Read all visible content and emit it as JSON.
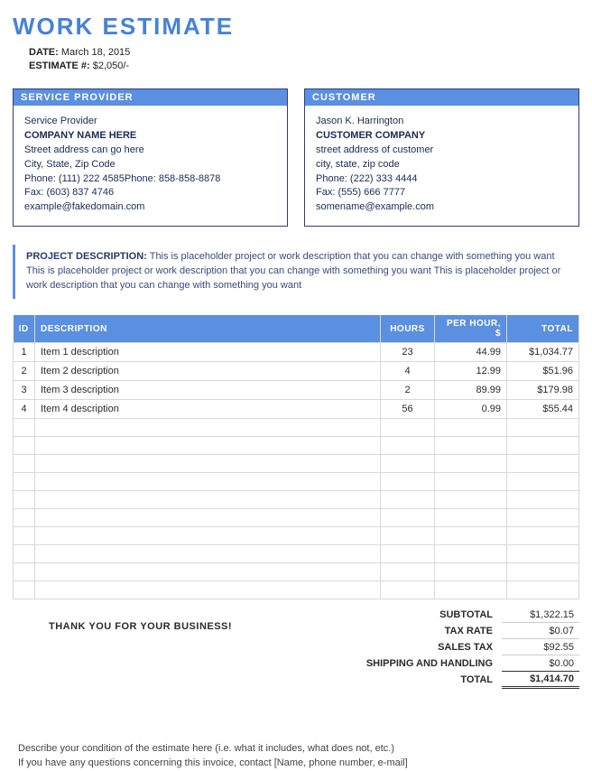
{
  "header": {
    "title": "WORK ESTIMATE",
    "date_label": "DATE:",
    "date_value": "March 18, 2015",
    "estimate_label": "ESTIMATE #:",
    "estimate_value": "$2,050/-"
  },
  "provider": {
    "heading": "SERVICE PROVIDER",
    "line1": "Service Provider",
    "company": "COMPANY NAME HERE",
    "address1": "Street address can go here",
    "address2": "City, State, Zip Code",
    "phone": "Phone:  (111) 222 4585Phone: 858-858-8878",
    "fax": "Fax: (603) 837 4746",
    "email": "example@fakedomain.com"
  },
  "customer": {
    "heading": "CUSTOMER",
    "line1": "Jason K. Harrington",
    "company": "CUSTOMER COMPANY",
    "address1": "street address of customer",
    "address2": "city, state, zip code",
    "phone": "Phone: (222) 333 4444",
    "fax": "Fax: (555) 666 7777",
    "email": "somename@example.com"
  },
  "project": {
    "label": "PROJECT DESCRIPTION:",
    "text": "This is placeholder project or work description that you can change with something you want This is placeholder project or work description that you can change with something you want  This is placeholder project or work description that you can change with something you want"
  },
  "table": {
    "headers": {
      "id": "ID",
      "desc": "DESCRIPTION",
      "hours": "HOURS",
      "rate": "PER HOUR, $",
      "total": "TOTAL"
    },
    "rows": [
      {
        "id": "1",
        "desc": "Item 1 description",
        "hours": "23",
        "rate": "44.99",
        "total": "$1,034.77"
      },
      {
        "id": "2",
        "desc": "Item 2 description",
        "hours": "4",
        "rate": "12.99",
        "total": "$51.96"
      },
      {
        "id": "3",
        "desc": "Item 3 description",
        "hours": "2",
        "rate": "89.99",
        "total": "$179.98"
      },
      {
        "id": "4",
        "desc": "Item 4 description",
        "hours": "56",
        "rate": "0.99",
        "total": "$55.44"
      }
    ],
    "empty_rows": 10
  },
  "thankyou": "THANK YOU FOR YOUR BUSINESS!",
  "totals": {
    "subtotal_label": "SUBTOTAL",
    "subtotal": "$1,322.15",
    "taxrate_label": "TAX RATE",
    "taxrate": "$0.07",
    "salestax_label": "SALES TAX",
    "salestax": "$92.55",
    "shipping_label": "SHIPPING AND HANDLING",
    "shipping": "$0.00",
    "total_label": "TOTAL",
    "total": "$1,414.70"
  },
  "footer": {
    "line1": "Describe your condition of the estimate here (i.e. what it includes, what does not, etc.)",
    "line2": "If you have any questions concerning this invoice, contact [Name, phone number, e-mail]"
  }
}
